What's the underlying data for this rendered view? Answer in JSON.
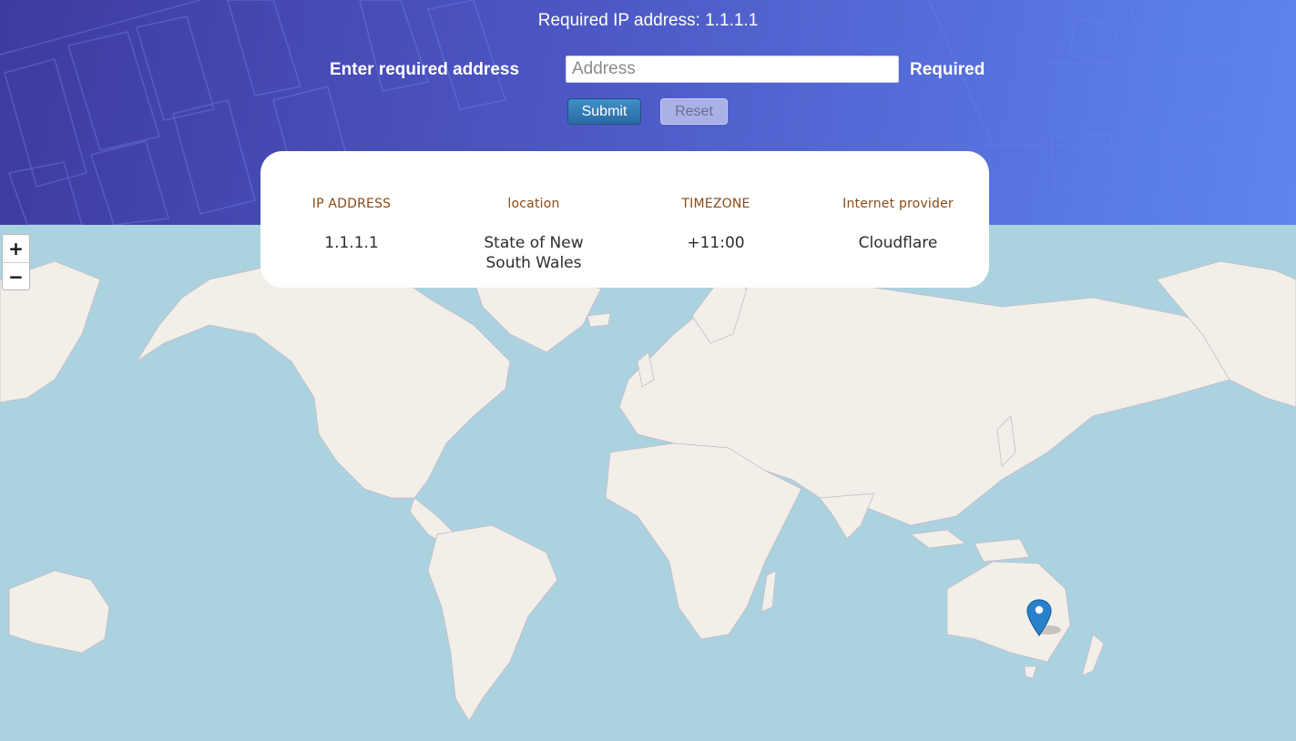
{
  "header": {
    "title": "Required IP address: 1.1.1.1",
    "field_label": "Enter required address",
    "input": {
      "placeholder": "Address",
      "value": ""
    },
    "required_label": "Required",
    "submit_label": "Submit",
    "reset_label": "Reset"
  },
  "info_card": {
    "columns": [
      {
        "heading": "IP ADDRESS",
        "value": "1.1.1.1"
      },
      {
        "heading": "location",
        "value": "State of New South Wales"
      },
      {
        "heading": "TIMEZONE",
        "value": "+11:00"
      },
      {
        "heading": "Internet provider",
        "value": "Cloudflare"
      }
    ]
  },
  "map": {
    "zoom_in_label": "+",
    "zoom_out_label": "−",
    "marker_icon": "map-pin-icon"
  },
  "colors": {
    "header_gradient_start": "#3f3a9e",
    "header_gradient_end": "#5e86ee",
    "ocean": "#aad3df",
    "land": "#f2efe9",
    "heading_text": "#8a4a16",
    "marker": "#2a81cb"
  }
}
